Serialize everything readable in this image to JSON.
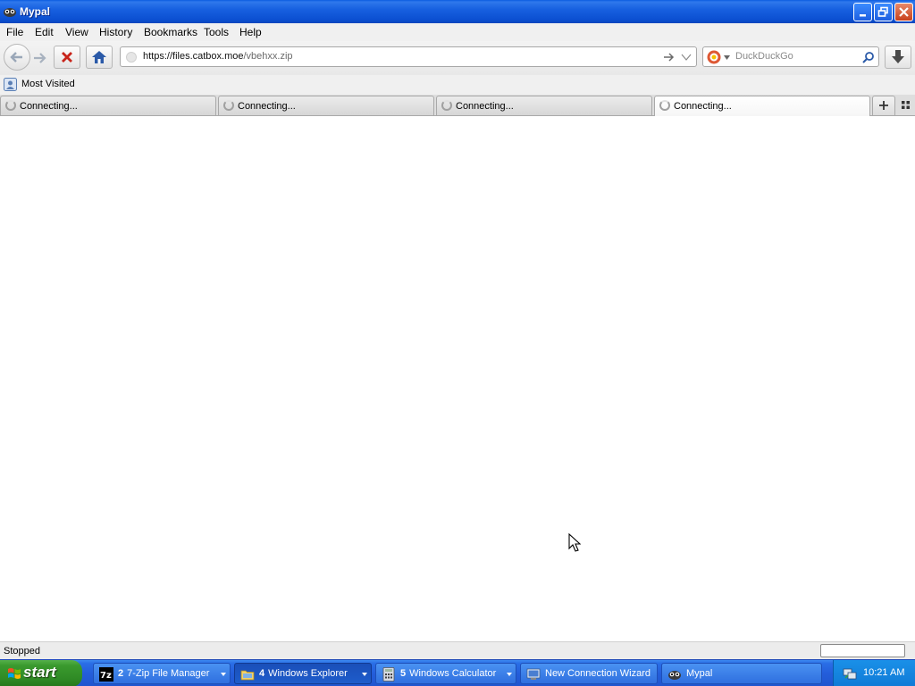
{
  "window": {
    "title": "Mypal",
    "icons": {
      "minimize": "minimize-icon",
      "restore": "restore-icon",
      "close": "close-icon"
    }
  },
  "menu": {
    "items": [
      "File",
      "Edit",
      "View",
      "History",
      "Bookmarks",
      "Tools",
      "Help"
    ]
  },
  "toolbar": {
    "url_host": "https://files.catbox.moe",
    "url_path": "/vbehxx.zip",
    "search_placeholder": "DuckDuckGo",
    "icons": [
      "back-icon",
      "forward-icon",
      "stop-icon",
      "home-icon",
      "go-arrow-icon",
      "dropdown-icon",
      "search-icon",
      "download-icon"
    ]
  },
  "bookmarks": {
    "items": [
      {
        "label": "Most Visited",
        "icon": "bookmark-folder-icon"
      }
    ]
  },
  "tabs": {
    "items": [
      {
        "label": "Connecting...",
        "active": false
      },
      {
        "label": "Connecting...",
        "active": false
      },
      {
        "label": "Connecting...",
        "active": false
      },
      {
        "label": "Connecting...",
        "active": true
      }
    ]
  },
  "status": {
    "text": "Stopped"
  },
  "taskbar": {
    "start_label": "start",
    "tasks": [
      {
        "number": "2",
        "label": "7-Zip File Manager",
        "icon": "7zip-icon",
        "active": false,
        "grouped": true
      },
      {
        "number": "4",
        "label": "Windows Explorer",
        "icon": "folder-icon",
        "active": true,
        "grouped": true
      },
      {
        "number": "5",
        "label": "Windows Calculator",
        "icon": "calculator-icon",
        "active": false,
        "grouped": true
      },
      {
        "number": "",
        "label": "New Connection Wizard",
        "icon": "network-wizard-icon",
        "active": false,
        "grouped": false
      },
      {
        "number": "",
        "label": "Mypal",
        "icon": "mypal-icon",
        "active": false,
        "grouped": false
      }
    ],
    "clock": "10:21 AM"
  },
  "colors": {
    "titlebar": "#0b4fd1",
    "taskbar": "#245edb",
    "start_button": "#3a9a2e",
    "tray": "#0f7ad6"
  }
}
